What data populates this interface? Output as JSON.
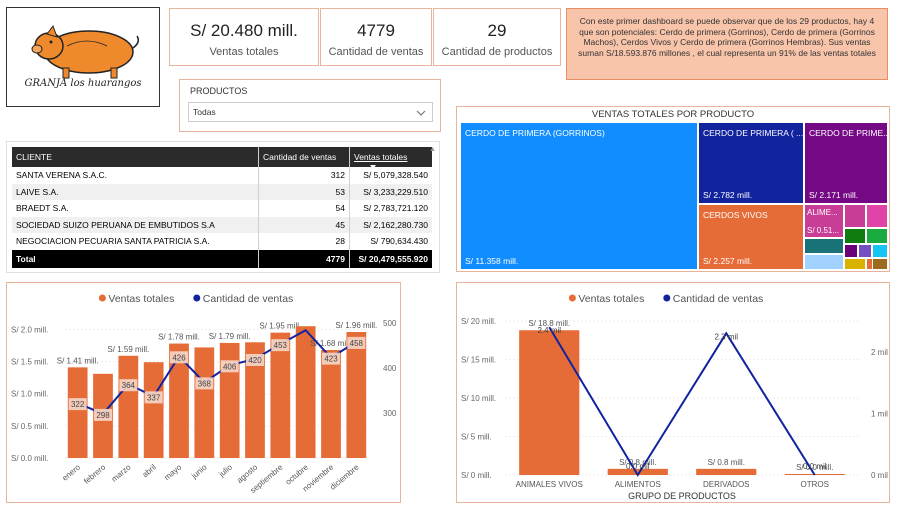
{
  "logo": {
    "text": "GRANJA los huarangos"
  },
  "kpis": [
    {
      "value": "S/ 20.480 mill.",
      "label": "Ventas totales"
    },
    {
      "value": "4779",
      "label": "Cantidad de ventas"
    },
    {
      "value": "29",
      "label": "Cantidad de productos"
    }
  ],
  "note": "Con este primer dashboard se puede observar que de los 29 productos, hay 4 que son potenciales: Cerdo de primera (Gorrinos), Cerdo de primera (Gorrinos Machos), Cerdos Vivos y Cerdo de primera (Gorrinos Hembras). Sus ventas suman S/18.593.876 millones , el cual representa un 91% de las ventas totales",
  "filter": {
    "label": "PRODUCTOS",
    "value": "Todas"
  },
  "customers": {
    "headers": [
      "CLIENTE",
      "Cantidad de ventas",
      "Ventas totales"
    ],
    "rows": [
      {
        "name": "SANTA VERENA S.A.C.",
        "qty": "312",
        "sales": "S/ 5,079,328.540"
      },
      {
        "name": "LAIVE S.A.",
        "qty": "53",
        "sales": "S/ 3,233,229.510"
      },
      {
        "name": "BRAEDT S.A.",
        "qty": "54",
        "sales": "S/ 2,783,721.120"
      },
      {
        "name": "SOCIEDAD SUIZO PERUANA DE EMBUTIDOS S.A",
        "qty": "45",
        "sales": "S/ 2,162,280.730"
      },
      {
        "name": "NEGOCIACION PECUARIA SANTA PATRICIA S.A.",
        "qty": "28",
        "sales": "S/ 790,634.430"
      }
    ],
    "total": {
      "name": "Total",
      "qty": "4779",
      "sales": "S/ 20,479,555.920"
    }
  },
  "treemap": {
    "title": "VENTAS TOTALES POR PRODUCTO",
    "tiles": [
      {
        "name": "CERDO DE PRIMERA (GORRINOS)",
        "value": "S/ 11.358 mill.",
        "color": "#118dff"
      },
      {
        "name": "CERDO DE PRIMERA ( ...",
        "value": "S/ 2.782 mill.",
        "color": "#12239e"
      },
      {
        "name": "CERDO DE PRIME...",
        "value": "S/ 2.171 mill.",
        "color": "#750985"
      },
      {
        "name": "CERDOS VIVOS",
        "value": "S/ 2.257 mill.",
        "color": "#e66c37"
      },
      {
        "name": "ALIME...",
        "value": "S/ 0.51...",
        "color": "#c83d95"
      }
    ],
    "small_colors": [
      "#c83d95",
      "#e044a7",
      "#107c10",
      "#1aab40",
      "#197278",
      "#6b007b",
      "#744ec2",
      "#15c6f4",
      "#a0d1ff",
      "#d9b300",
      "#e66c37",
      "#9c6b1d"
    ]
  },
  "chart_data": [
    {
      "type": "bar",
      "legend": [
        "Ventas totales",
        "Cantidad de ventas"
      ],
      "legend_position": "top-center",
      "categories": [
        "enero",
        "febrero",
        "marzo",
        "abril",
        "mayo",
        "junio",
        "julio",
        "agosto",
        "septiembre",
        "octubre",
        "noviembre",
        "diciembre"
      ],
      "series": [
        {
          "name": "Ventas totales",
          "type": "bar",
          "axis": "left",
          "values": [
            1.41,
            1.31,
            1.59,
            1.49,
            1.78,
            1.72,
            1.79,
            1.8,
            1.95,
            2.05,
            1.68,
            1.96
          ],
          "labels": [
            "S/ 1.41 mill.",
            "",
            "S/ 1.59 mill.",
            "",
            "S/ 1.78 mill.",
            "",
            "S/ 1.79 mill.",
            "",
            "S/ 1.95 mill.",
            "",
            "S/ 1.68 mill.",
            "S/ 1.96 mill."
          ],
          "color": "#e66c37"
        },
        {
          "name": "Cantidad de ventas",
          "type": "line",
          "axis": "right",
          "values": [
            322,
            298,
            364,
            337,
            426,
            368,
            406,
            420,
            453,
            484,
            423,
            458
          ],
          "labels": [
            "322",
            "298",
            "364",
            "337",
            "426",
            "368",
            "406",
            "420",
            "453",
            "",
            "423",
            "458"
          ],
          "color": "#12239e"
        }
      ],
      "y_left": {
        "ticks": [
          "S/ 0.0 mill.",
          "S/ 0.5 mill.",
          "S/ 1.0 mill.",
          "S/ 1.5 mill.",
          "S/ 2.0 mill."
        ],
        "range": [
          0,
          2.1
        ]
      },
      "y_right": {
        "ticks": [
          "300",
          "400",
          "500"
        ],
        "range": [
          200,
          500
        ]
      }
    },
    {
      "type": "bar",
      "legend": [
        "Ventas totales",
        "Cantidad de ventas"
      ],
      "legend_position": "top-center",
      "xlabel": "GRUPO DE PRODUCTOS",
      "categories": [
        "ANIMALES VIVOS",
        "ALIMENTOS",
        "DERIVADOS",
        "OTROS"
      ],
      "series": [
        {
          "name": "Ventas totales",
          "type": "bar",
          "axis": "left",
          "values": [
            18.8,
            0.8,
            0.8,
            0.0
          ],
          "labels": [
            "S/ 18.8 mill.",
            "S/ 0.8 mill.",
            "S/ 0.8 mill.",
            "S/ 0.0 mill."
          ],
          "color": "#e66c37"
        },
        {
          "name": "Cantidad de ventas",
          "type": "line",
          "axis": "right",
          "values": [
            2.4,
            0.0,
            2.3,
            0.0
          ],
          "labels": [
            "2.4 mil",
            "0.0 mil",
            "2.3 mil",
            "0.0 mil"
          ],
          "color": "#12239e"
        }
      ],
      "y_left": {
        "ticks": [
          "S/ 0 mill.",
          "S/ 5 mill.",
          "S/ 10 mill.",
          "S/ 15 mill.",
          "S/ 20 mill."
        ],
        "range": [
          0,
          20
        ]
      },
      "y_right": {
        "ticks": [
          "0 mil",
          "1 mil",
          "2 mil"
        ],
        "range": [
          0,
          2.5
        ]
      }
    }
  ]
}
